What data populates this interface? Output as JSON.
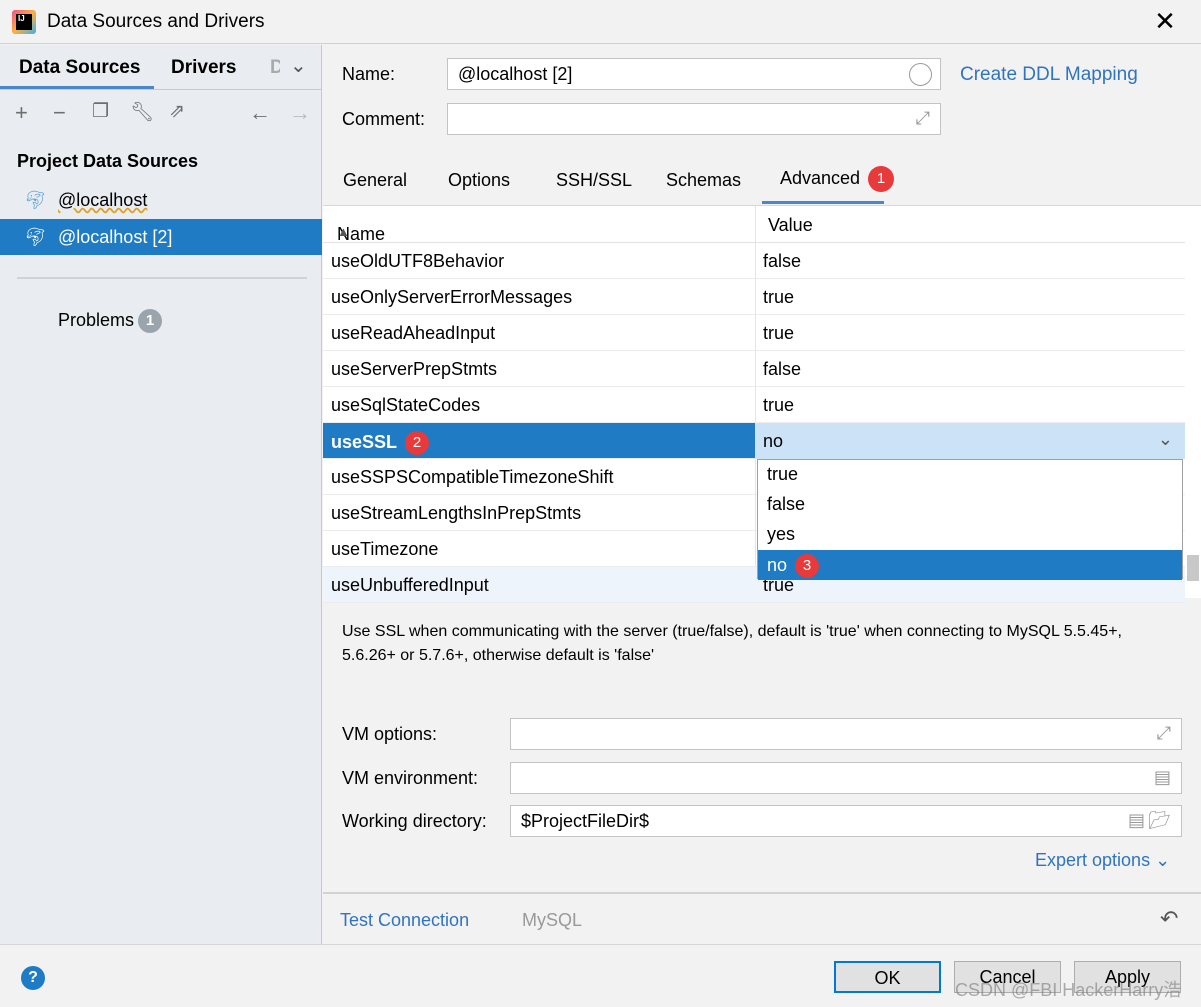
{
  "window": {
    "title": "Data Sources and Drivers",
    "close_icon": "close-icon",
    "app_icon_text": "IJ"
  },
  "left": {
    "tabs": [
      "Data Sources",
      "Drivers",
      "D"
    ],
    "section_title": "Project Data Sources",
    "items": [
      {
        "label": "@localhost",
        "icon": "mysql-dolphin-icon"
      },
      {
        "label": "@localhost [2]",
        "icon": "mysql-dolphin-icon",
        "selected": true
      }
    ],
    "problems_label": "Problems",
    "problems_count": "1"
  },
  "form": {
    "name_label": "Name:",
    "name_value": "@localhost [2]",
    "comment_label": "Comment:",
    "comment_value": "",
    "ddl_link": "Create DDL Mapping"
  },
  "tabs": [
    {
      "label": "General"
    },
    {
      "label": "Options"
    },
    {
      "label": "SSH/SSL"
    },
    {
      "label": "Schemas"
    },
    {
      "label": "Advanced",
      "active": true,
      "badge": "1"
    }
  ],
  "table": {
    "headers": [
      "Name",
      "Value"
    ],
    "rows": [
      {
        "name": "useOldUTF8Behavior",
        "value": "false"
      },
      {
        "name": "useOnlyServerErrorMessages",
        "value": "true"
      },
      {
        "name": "useReadAheadInput",
        "value": "true"
      },
      {
        "name": "useServerPrepStmts",
        "value": "false"
      },
      {
        "name": "useSqlStateCodes",
        "value": "true"
      },
      {
        "name": "useSSL",
        "value": "no",
        "selected": true,
        "badge": "2"
      },
      {
        "name": "useSSPSCompatibleTimezoneShift",
        "value": ""
      },
      {
        "name": "useStreamLengthsInPrepStmts",
        "value": ""
      },
      {
        "name": "useTimezone",
        "value": ""
      },
      {
        "name": "useUnbufferedInput",
        "value": "true"
      }
    ],
    "dropdown_options": [
      "true",
      "false",
      "yes",
      "no"
    ],
    "dropdown_selected": "no",
    "dropdown_badge": "3"
  },
  "description": "Use SSL when communicating with the server (true/false), default is 'true' when connecting to MySQL 5.5.45+, 5.6.26+ or 5.7.6+, otherwise default is 'false'",
  "vm": {
    "options_label": "VM options:",
    "options_value": "",
    "env_label": "VM environment:",
    "env_value": "",
    "wd_label": "Working directory:",
    "wd_value": "$ProjectFileDir$",
    "expert": "Expert options"
  },
  "footer": {
    "test_connection": "Test Connection",
    "driver": "MySQL",
    "ok": "OK",
    "cancel": "Cancel",
    "apply": "Apply",
    "help": "?"
  },
  "watermark": "CSDN @FBI HackerHarry浩",
  "colors": {
    "accent": "#1e7bc4",
    "badge_red": "#e83a3a",
    "link": "#2f74c0"
  }
}
